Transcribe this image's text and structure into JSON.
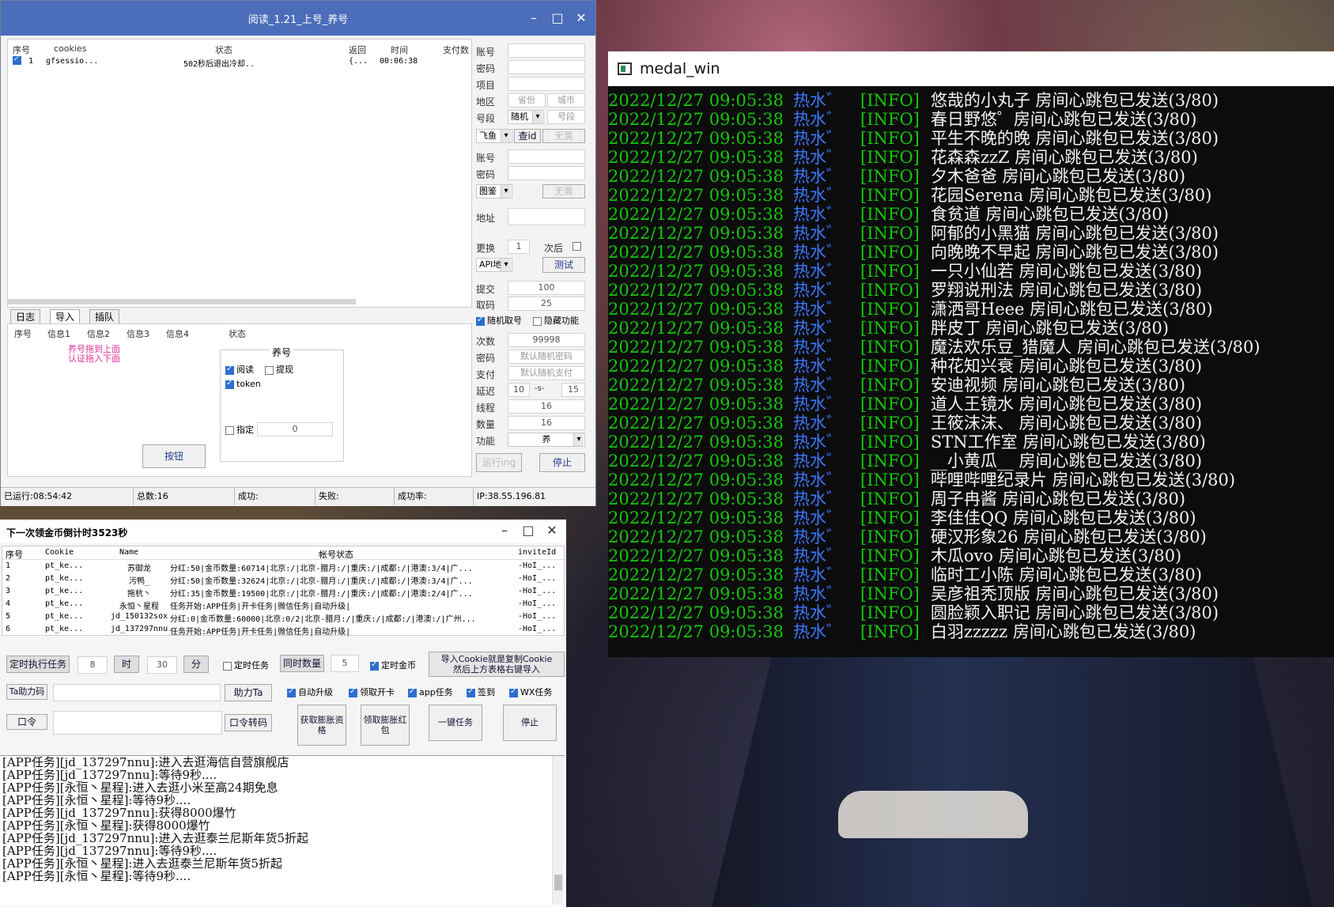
{
  "window1": {
    "title": "阅读_1.21_上号_养号",
    "table_headers": [
      "序号",
      "cookies",
      "状态",
      "返回",
      "时间",
      "支付数"
    ],
    "rows": [
      {
        "index": "1",
        "cookie": "gfsessio...",
        "status": "502秒后退出冷却..",
        "ret": "{...",
        "time": "00:06:38",
        "checked": true
      }
    ],
    "tabs": [
      "日志",
      "导入",
      "插队"
    ],
    "lower_headers": [
      "序号",
      "信息1",
      "信息2",
      "信息3",
      "信息4",
      "状态"
    ],
    "pink_hint_line1": "养号拖到上面",
    "pink_hint_line2": "认证拖入下面",
    "yanghao_group": {
      "title": "养号",
      "read_label": "阅读",
      "read_checked": true,
      "withdraw_label": "提现",
      "withdraw_checked": false,
      "token_label": "token",
      "token_checked": true,
      "specify_label": "指定",
      "specify_checked": false,
      "specify_value": "0"
    },
    "button_label": "按钮",
    "right_panel": {
      "account_label": "账号",
      "password_label": "密码",
      "project_label": "项目",
      "region_label": "地区",
      "province_placeholder": "省份",
      "city_placeholder": "城市",
      "segment_label": "号段",
      "segment_select": "随机",
      "segment_placeholder": "号段",
      "platform_select": "飞鱼",
      "query_id_button": "查id",
      "no_need_button": "无需",
      "account2_label": "账号",
      "password2_label": "密码",
      "captcha_select": "图鉴",
      "no_need2_button": "无需",
      "address_label": "地址",
      "change_label": "更换",
      "change_value": "1",
      "after_label": "次后",
      "api_select": "API地",
      "test_button": "测试",
      "submit_label": "提交",
      "submit_value": "100",
      "fetch_label": "取码",
      "fetch_value": "25",
      "random_fetch_label": "随机取号",
      "random_fetch_checked": true,
      "hidden_func_label": "隐藏功能",
      "hidden_func_checked": false,
      "times_label": "次数",
      "times_value": "99998",
      "pwd_label": "密码",
      "pwd_placeholder": "默认随机密码",
      "pay_label": "支付",
      "pay_placeholder": "默认随机支付",
      "delay_label": "延迟",
      "delay_min": "10",
      "delay_sep": "-s-",
      "delay_max": "15",
      "thread_label": "线程",
      "thread_value": "16",
      "count_label": "数量",
      "count_value": "16",
      "func_label": "功能",
      "func_select": "养",
      "start_button": "运行ing",
      "stop_button": "停止"
    },
    "status_bar": {
      "running": "已运行:08:54:42",
      "total": "总数:16",
      "success": "成功:",
      "fail": "失败:",
      "rate": "成功率:",
      "ip": "IP:38.55.196.81"
    }
  },
  "window2": {
    "title": "下一次领金币倒计时3523秒",
    "headers": [
      "序号",
      "Cookie",
      "Name",
      "帐号状态",
      "inviteId"
    ],
    "rows": [
      {
        "idx": "1",
        "cookie": "pt_ke...",
        "name": "苏御龙",
        "status": "分红:50|金币数量:60714|北京:/|北京-腊月:/|重庆:/|成都:/|港澳:3/4|广...",
        "invite": "-HoI_..."
      },
      {
        "idx": "2",
        "cookie": "pt_ke...",
        "name": "污鸭_",
        "status": "分红:50|金币数量:32624|北京:/|北京-腊月:/|重庆:/|成都:/|港澳:3/4|广...",
        "invite": "-HoI_..."
      },
      {
        "idx": "3",
        "cookie": "pt_ke...",
        "name": "拖杭丶",
        "status": "分红:35|金币数量:19500|北京:/|北京-腊月:/|重庆:/|成都:/|港澳:2/4|广...",
        "invite": "-HoI_..."
      },
      {
        "idx": "4",
        "cookie": "pt_ke...",
        "name": "永恒丶星程",
        "status": "任务开始:APP任务|开卡任务|微信任务|自动升级|",
        "invite": "-HoI_..."
      },
      {
        "idx": "5",
        "cookie": "pt_ke...",
        "name": "jd_150132sox",
        "status": "分红:0|金币数量:60000|北京:0/2|北京-腊月:/|重庆:/|成都:/|港澳:/|广州...",
        "invite": "-HoI_..."
      },
      {
        "idx": "6",
        "cookie": "pt_ke...",
        "name": "jd_137297nnu",
        "status": "任务开始:APP任务|开卡任务|微信任务|自动升级|",
        "invite": "-HoI_..."
      }
    ],
    "timed_task_button": "定时执行任务",
    "hour_value": "8",
    "hour_button": "时",
    "minute_value": "30",
    "minute_button": "分",
    "timed_task_chk_label": "定时任务",
    "timed_task_checked": false,
    "concurrent_button": "同时数量",
    "concurrent_value": "5",
    "timed_gold_label": "定时金币",
    "timed_gold_checked": true,
    "import_hint_line1": "导入Cookie就是复制Cookie",
    "import_hint_line2": "然后上方表格右键导入",
    "ta_help_code_button": "Ta助力码",
    "help_ta_button": "助力Ta",
    "auto_upgrade_label": "自动升级",
    "auto_upgrade_checked": true,
    "open_card_label": "领取开卡",
    "open_card_checked": true,
    "app_task_label": "app任务",
    "app_task_checked": true,
    "signin_label": "签到",
    "signin_checked": true,
    "wx_task_label": "WX任务",
    "wx_task_checked": true,
    "command_button": "口令",
    "command_convert_button": "口令转码",
    "get_inflate_button": "获取膨胀资格",
    "claim_inflate_button": "领取膨胀红包",
    "one_key_button": "一键任务",
    "stop_button": "停止",
    "log_lines": [
      "[APP任务][jd_137297nnu]:进入去逛海信自营旗舰店",
      "[APP任务][jd_137297nnu]:等待9秒....",
      "[APP任务][永恒丶星程]:进入去逛小米至高24期免息",
      "[APP任务][永恒丶星程]:等待9秒....",
      "[APP任务][jd_137297nnu]:获得8000爆竹",
      "[APP任务][永恒丶星程]:获得8000爆竹",
      "[APP任务][jd_137297nnu]:进入去逛泰兰尼斯年货5折起",
      "[APP任务][jd_137297nnu]:等待9秒....",
      "[APP任务][永恒丶星程]:进入去逛泰兰尼斯年货5折起",
      "[APP任务][永恒丶星程]:等待9秒...."
    ]
  },
  "medal_win": {
    "title": "medal_win",
    "timestamp": "2022/12/27 09:05:38",
    "sender": "热水゛",
    "level": "[INFO]",
    "lines": [
      "悠哉的小丸子 房间心跳包已发送(3/80)",
      "春日野悠゜房间心跳包已发送(3/80)",
      "平生不晚的晚 房间心跳包已发送(3/80)",
      "花森森zzZ 房间心跳包已发送(3/80)",
      "夕木爸爸 房间心跳包已发送(3/80)",
      "花园Serena 房间心跳包已发送(3/80)",
      "食贫道 房间心跳包已发送(3/80)",
      "阿郁的小黑猫 房间心跳包已发送(3/80)",
      "向晚晚不早起 房间心跳包已发送(3/80)",
      "一只小仙若 房间心跳包已发送(3/80)",
      "罗翔说刑法 房间心跳包已发送(3/80)",
      "潇洒哥Heee 房间心跳包已发送(3/80)",
      "胖皮丁 房间心跳包已发送(3/80)",
      "魔法欢乐豆_猎魔人 房间心跳包已发送(3/80)",
      "种花知兴衰 房间心跳包已发送(3/80)",
      "安迪视频 房间心跳包已发送(3/80)",
      "道人王镜水 房间心跳包已发送(3/80)",
      "王筱沫沫、 房间心跳包已发送(3/80)",
      "STN工作室 房间心跳包已发送(3/80)",
      "__小黄瓜__ 房间心跳包已发送(3/80)",
      "哔哩哔哩纪录片 房间心跳包已发送(3/80)",
      "周子冉酱 房间心跳包已发送(3/80)",
      "李佳佳QQ 房间心跳包已发送(3/80)",
      "硬汉形象26 房间心跳包已发送(3/80)",
      "木瓜ovo 房间心跳包已发送(3/80)",
      "临时工小陈 房间心跳包已发送(3/80)",
      "吴彦祖秃顶版 房间心跳包已发送(3/80)",
      "圆脸颖入职记 房间心跳包已发送(3/80)",
      "白羽zzzzz 房间心跳包已发送(3/80)"
    ]
  }
}
